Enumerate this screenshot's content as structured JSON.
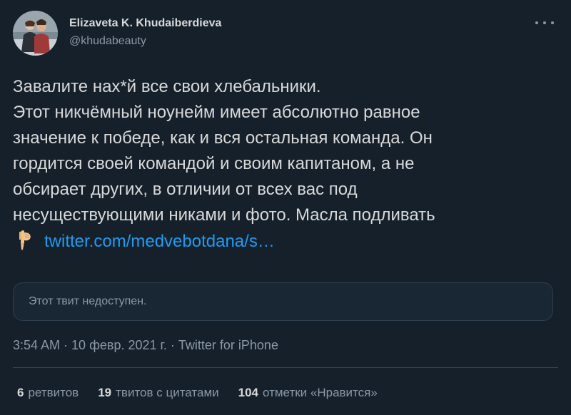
{
  "author": {
    "display_name": "Elizaveta K. Khudaiberdieva",
    "handle": "@khudabeauty",
    "avatar_icon": "profile-photo"
  },
  "tweet": {
    "lines": [
      "Завалите нах*й все свои хлебальники.",
      "Этот никчёмный ноунейм имеет абсолютно равное",
      "значение к победе, как и вся остальная команда. Он",
      "гордится своей командой и своим капитаном, а не",
      "обсирает других, в отличии от всех вас под",
      "несуществующими никами и фото. Масла подливать"
    ],
    "emoji_icon": "backhand-index-pointing-down",
    "link_text": "twitter.com/medvebotdana/s…"
  },
  "quoted": {
    "unavailable_text": "Этот твит недоступен."
  },
  "meta": {
    "time": "3:54 AM",
    "separator": " · ",
    "date": "10 февр. 2021 г.",
    "source": "Twitter for iPhone"
  },
  "stats": {
    "retweets_count": "6",
    "retweets_label": "ретвитов",
    "quotes_count": "19",
    "quotes_label": "твитов с цитатами",
    "likes_count": "104",
    "likes_label": "отметки «Нравится»"
  },
  "colors": {
    "background": "#15202b",
    "text": "#d9d9d9",
    "secondary": "#8b98a5",
    "link": "#1d9bf0"
  }
}
